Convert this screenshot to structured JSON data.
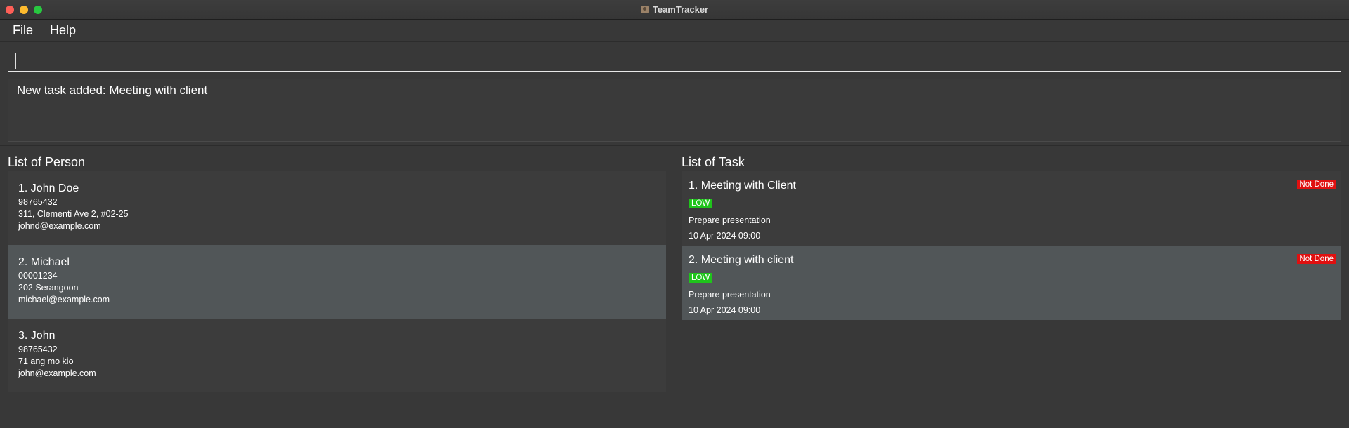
{
  "window": {
    "title": "TeamTracker"
  },
  "menu": {
    "file": "File",
    "help": "Help"
  },
  "command": {
    "value": ""
  },
  "result": {
    "message": "New task added: Meeting with client"
  },
  "persons": {
    "title": "List of Person",
    "items": [
      {
        "name": "1.  John Doe",
        "phone": "98765432",
        "address": "311, Clementi Ave 2, #02-25",
        "email": "johnd@example.com"
      },
      {
        "name": "2.  Michael",
        "phone": "00001234",
        "address": "202 Serangoon",
        "email": "michael@example.com"
      },
      {
        "name": "3.  John",
        "phone": "98765432",
        "address": "71 ang mo kio",
        "email": "john@example.com"
      }
    ]
  },
  "tasks": {
    "title": "List of Task",
    "items": [
      {
        "name": "1. Meeting with Client",
        "priority": "LOW",
        "status": "Not Done",
        "description": "Prepare presentation",
        "deadline": "10 Apr 2024 09:00"
      },
      {
        "name": "2. Meeting with client",
        "priority": "LOW",
        "status": "Not Done",
        "description": "Prepare presentation",
        "deadline": "10 Apr 2024 09:00"
      }
    ]
  },
  "colors": {
    "priority_low": "#1fc41b",
    "status_not_done": "#e01010",
    "selected_card": "#515658"
  }
}
